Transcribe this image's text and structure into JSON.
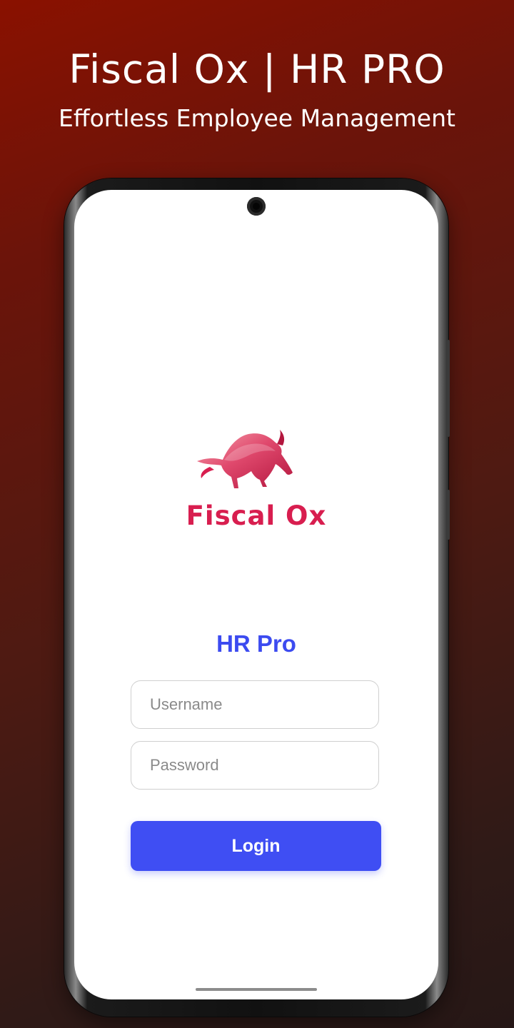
{
  "promo": {
    "title": "Fiscal Ox | HR PRO",
    "subtitle": "Effortless Employee Management"
  },
  "app": {
    "logo_text": "Fiscal Ox",
    "heading": "HR Pro",
    "username_placeholder": "Username",
    "username_value": "",
    "password_placeholder": "Password",
    "password_value": "",
    "login_label": "Login"
  },
  "colors": {
    "brand": "#d81e4f",
    "accent": "#3f4ef3",
    "background_start": "#8a1100",
    "background_end": "#261716"
  },
  "icons": {
    "logo": "bull-logo-icon",
    "camera": "front-camera-icon"
  }
}
